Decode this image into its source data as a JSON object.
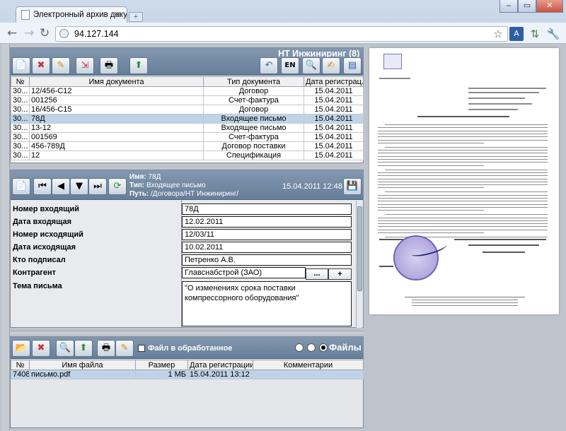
{
  "browser": {
    "tab_title": "Электронный архив доку...",
    "new_tab": "+",
    "url": "94.127.144",
    "window_buttons": {
      "minimize": "–",
      "maximize": "▭",
      "close": "✕"
    }
  },
  "archive": {
    "group_title": "НТ Инжиниринг (8)",
    "lang_button": "EN",
    "columns": [
      "№",
      "Имя документа",
      "Тип документа",
      "Дата регистрац..."
    ],
    "rows": [
      {
        "num": "30...",
        "name": "12/456-С12",
        "type": "Договор",
        "date": "15.04.2011"
      },
      {
        "num": "30...",
        "name": "001256",
        "type": "Счет-фактура",
        "date": "15.04.2011"
      },
      {
        "num": "30...",
        "name": "16/456-С15",
        "type": "Договор",
        "date": "15.04.2011"
      },
      {
        "num": "30...",
        "name": "78Д",
        "type": "Входящее письмо",
        "date": "15.04.2011"
      },
      {
        "num": "30...",
        "name": "13-12",
        "type": "Входящее письмо",
        "date": "15.04.2011"
      },
      {
        "num": "30...",
        "name": "001569",
        "type": "Счет-фактура",
        "date": "15.04.2011"
      },
      {
        "num": "30...",
        "name": "456-789Д",
        "type": "Договор поставки",
        "date": "15.04.2011"
      },
      {
        "num": "30...",
        "name": "12",
        "type": "Спецификация",
        "date": "15.04.2011"
      }
    ],
    "selected_row": 3
  },
  "card": {
    "name_label": "Имя:",
    "name_value": "78Д",
    "type_label": "Тип:",
    "type_value": "Входящее письмо",
    "path_label": "Путь:",
    "path_value": "/Договора/НТ Инжиниринг/",
    "timestamp": "15.04.2011 12:48",
    "fields": [
      {
        "label": "Номер входящий",
        "value": "78Д"
      },
      {
        "label": "Дата входящая",
        "value": "12.02.2011"
      },
      {
        "label": "Номер исходящий",
        "value": "12/03/11"
      },
      {
        "label": "Дата исходящая",
        "value": "10.02.2011"
      },
      {
        "label": "Кто подписал",
        "value": "Петренко А.В."
      },
      {
        "label": "Контрагент",
        "value": "Главснабстрой (ЗАО)"
      }
    ],
    "counterparty_more": "...",
    "counterparty_add": "+",
    "subject_label": "Тема письма",
    "subject_value": "\"О изменениях срока поставки компрессорного оборудования\""
  },
  "files": {
    "processed_label": "Файл в обработанное",
    "files_label": "Файлы",
    "columns": [
      "№",
      "Имя файла",
      "Размер",
      "Дата регистрации",
      "Комментарии"
    ],
    "rows": [
      {
        "num": "7408",
        "name": "письмо.pdf",
        "size": "1 МБ",
        "date": "15.04.2011 13:12",
        "comment": ""
      }
    ]
  },
  "colors": {
    "header_blue": "#7389a4",
    "selection": "#bfd3e8",
    "seal": "#6f62b8"
  }
}
